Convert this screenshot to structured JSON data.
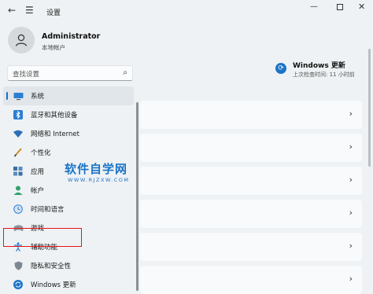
{
  "titlebar": {
    "title": "设置"
  },
  "profile": {
    "name": "Administrator",
    "type": "本地帐户"
  },
  "search": {
    "placeholder": "查找设置"
  },
  "nav": {
    "items": [
      {
        "label": "系统",
        "icon": "monitor-icon"
      },
      {
        "label": "蓝牙和其他设备",
        "icon": "bluetooth-icon"
      },
      {
        "label": "网络和 Internet",
        "icon": "wifi-icon"
      },
      {
        "label": "个性化",
        "icon": "brush-icon"
      },
      {
        "label": "应用",
        "icon": "apps-icon"
      },
      {
        "label": "帐户",
        "icon": "person-icon"
      },
      {
        "label": "时间和语言",
        "icon": "globe-clock-icon"
      },
      {
        "label": "游戏",
        "icon": "gamepad-icon"
      },
      {
        "label": "辅助功能",
        "icon": "accessibility-icon"
      },
      {
        "label": "隐私和安全性",
        "icon": "shield-icon"
      },
      {
        "label": "Windows 更新",
        "icon": "update-icon"
      }
    ],
    "selected": "系统",
    "highlighted": "个性化"
  },
  "update": {
    "title": "Windows 更新",
    "subtitle": "上次检查时间: 11 小时前"
  },
  "watermark": {
    "title": "软件自学网",
    "url": "WWW.RJZXW.COM"
  },
  "colors": {
    "accent": "#1a6fc4",
    "highlight_border": "#e8141a",
    "watermark": "#1a73c7"
  }
}
